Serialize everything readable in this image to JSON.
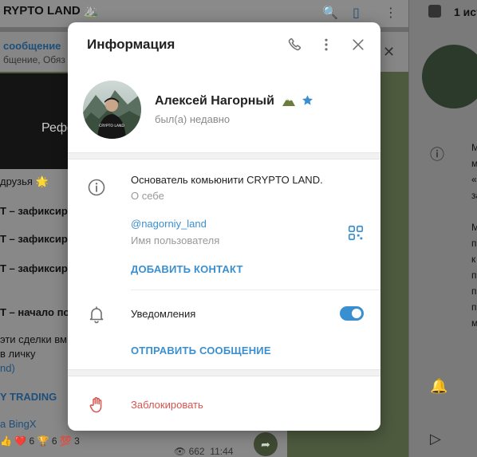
{
  "background": {
    "chat_title": "RYPTO LAND ⛰️",
    "pinned_title": "сообщение",
    "pinned_text": "бщение, Обяз",
    "media_text": "Рефе",
    "lines": [
      {
        "text": "друзья 🌟",
        "link": false
      },
      {
        "text": "Т – зафиксиро",
        "link": false
      },
      {
        "text": "Т – зафиксиров",
        "link": false
      },
      {
        "text": "Т – зафиксиров",
        "link": false
      },
      {
        "text": "Т – начало пол",
        "link": false
      },
      {
        "text": "эти сделки вм",
        "link": false
      },
      {
        "text": "в личку",
        "link": false
      },
      {
        "text": "nd)",
        "link": true
      },
      {
        "text": "Y TRADING",
        "link": true
      },
      {
        "text": "a BingX",
        "link": true
      }
    ],
    "reactions": "👍 ❤️ 6 🏆 6 💯 3",
    "views": "662",
    "time": "11:44",
    "right_panel_title": "1 ист",
    "right_panel_letters": [
      "М",
      "м",
      "«",
      "за",
      "",
      "М",
      "п",
      "к",
      "п",
      "п",
      "п",
      "м"
    ]
  },
  "modal": {
    "title": "Информация",
    "profile": {
      "name": "Алексей Нагорный",
      "status": "был(а) недавно"
    },
    "bio": {
      "value": "Основатель комьюнити CRYPTO LAND.",
      "caption": "О себе"
    },
    "username": {
      "value": "@nagorniy_land",
      "caption": "Имя пользователя"
    },
    "add_contact": "ДОБАВИТЬ КОНТАКТ",
    "notifications": {
      "label": "Уведомления",
      "enabled": true
    },
    "send_message": "ОТПРАВИТЬ СООБЩЕНИЕ",
    "block": "Заблокировать"
  },
  "colors": {
    "accent": "#3a8fd0",
    "danger": "#d9534f",
    "overlay": "#6b6b6b"
  },
  "icons": {
    "phone": "phone-icon",
    "more": "more-vertical-icon",
    "close": "close-icon",
    "info": "info-icon",
    "qr": "qr-code-icon",
    "bell": "bell-icon",
    "hand": "hand-block-icon",
    "star": "premium-star-icon",
    "mountain": "mountain-emoji-icon"
  }
}
